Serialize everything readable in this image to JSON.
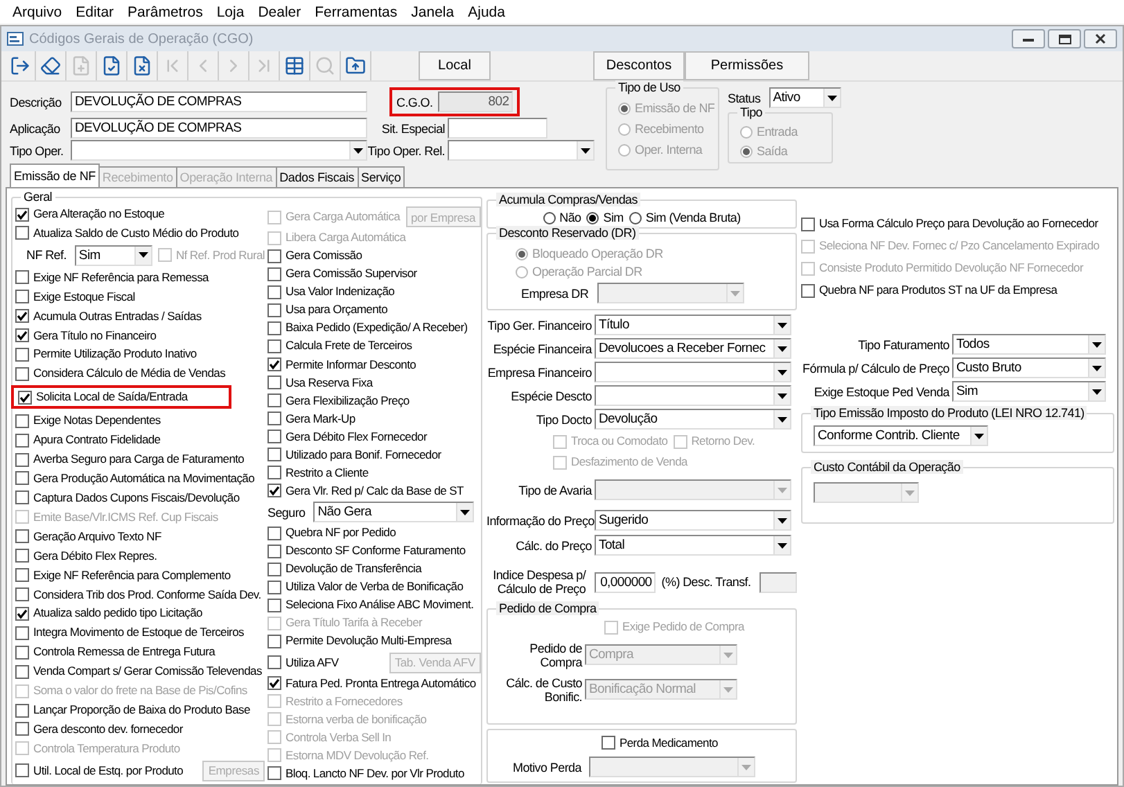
{
  "menu": [
    "Arquivo",
    "Editar",
    "Parâmetros",
    "Loja",
    "Dealer",
    "Ferramentas",
    "Janela",
    "Ajuda"
  ],
  "window": {
    "title": "Códigos Gerais de Operação (CGO)"
  },
  "toolbar": {
    "tools": [
      {
        "kind": "exit",
        "disabled": false
      },
      {
        "kind": "clear",
        "disabled": false
      },
      {
        "kind": "new",
        "disabled": true
      },
      {
        "kind": "save",
        "disabled": false
      },
      {
        "kind": "delete",
        "disabled": false
      },
      {
        "kind": "first",
        "disabled": true
      },
      {
        "kind": "previous",
        "disabled": true
      },
      {
        "kind": "next",
        "disabled": true
      },
      {
        "kind": "last",
        "disabled": true
      },
      {
        "kind": "grid",
        "disabled": false
      },
      {
        "kind": "search",
        "disabled": true
      },
      {
        "kind": "export",
        "disabled": false
      }
    ],
    "buttons": [
      {
        "label": "Local"
      },
      {
        "label": "Descontos"
      },
      {
        "label": "Permissões"
      }
    ]
  },
  "header": {
    "descricao": {
      "label": "Descrição",
      "value": "DEVOLUÇÃO DE COMPRAS"
    },
    "aplicacao": {
      "label": "Aplicação",
      "value": "DEVOLUÇÃO DE COMPRAS"
    },
    "tipo_oper": {
      "label": "Tipo Oper."
    },
    "cgo": {
      "label": "C.G.O.",
      "value": "802",
      "disabled": true,
      "highlighted": true
    },
    "sit_especial": {
      "label": "Sit. Especial"
    },
    "tipo_oper_rel": {
      "label": "Tipo Oper. Rel."
    },
    "tipo_de_uso": {
      "title": "Tipo de Uso",
      "disabled": true,
      "options": [
        {
          "label": "Emissão de NF",
          "selected": true
        },
        {
          "label": "Recebimento",
          "selected": false
        },
        {
          "label": "Oper. Interna",
          "selected": false
        }
      ]
    },
    "status": {
      "label": "Status",
      "value": "Ativo"
    },
    "tipo": {
      "title": "Tipo",
      "disabled": true,
      "options": [
        {
          "label": "Entrada",
          "selected": false
        },
        {
          "label": "Saída",
          "selected": true
        }
      ]
    }
  },
  "tabs": [
    {
      "label": "Emissão de NF",
      "selected": true,
      "disabled": false
    },
    {
      "label": "Recebimento",
      "selected": false,
      "disabled": true
    },
    {
      "label": "Operação Interna",
      "selected": false,
      "disabled": true
    },
    {
      "label": "Dados Fiscais",
      "selected": false,
      "disabled": false
    },
    {
      "label": "Serviço",
      "selected": false,
      "disabled": false
    }
  ],
  "geral": {
    "title": "Geral",
    "columns": [
      [
        {
          "kind": "checkbox",
          "label": "Gera Alteração no Estoque",
          "checked": true,
          "disabled": false
        },
        {
          "kind": "checkbox",
          "label": "Atualiza Saldo de Custo Médio do Produto",
          "checked": false,
          "disabled": false
        },
        {
          "kind": "select_check",
          "label": "NF Ref.",
          "value": "Sim",
          "check": {
            "label": "Nf Ref. Prod Rural",
            "checked": false,
            "disabled": true
          }
        },
        {
          "kind": "checkbox",
          "label": "Exige NF Referência para Remessa",
          "checked": false,
          "disabled": false
        },
        {
          "kind": "checkbox",
          "label": "Exige Estoque Fiscal",
          "checked": false,
          "disabled": false
        },
        {
          "kind": "checkbox",
          "label": "Acumula Outras Entradas / Saídas",
          "checked": true,
          "disabled": false
        },
        {
          "kind": "checkbox",
          "label": "Gera Título no Financeiro",
          "checked": true,
          "disabled": false
        },
        {
          "kind": "checkbox",
          "label": "Permite Utilização Produto Inativo",
          "checked": false,
          "disabled": false
        },
        {
          "kind": "checkbox",
          "label": "Considera Cálculo de Média de Vendas",
          "checked": false,
          "disabled": false
        },
        {
          "kind": "checkbox",
          "label": "Solicita Local de Saída/Entrada",
          "checked": true,
          "disabled": false,
          "highlighted": true
        },
        {
          "kind": "checkbox",
          "label": "Exige Notas Dependentes",
          "checked": false,
          "disabled": false
        },
        {
          "kind": "checkbox",
          "label": "Apura Contrato Fidelidade",
          "checked": false,
          "disabled": false
        },
        {
          "kind": "checkbox",
          "label": "Averba Seguro para Carga de Faturamento",
          "checked": false,
          "disabled": false
        },
        {
          "kind": "checkbox",
          "label": "Gera Produção Automática na Movimentação",
          "checked": false,
          "disabled": false
        },
        {
          "kind": "checkbox",
          "label": "Captura Dados Cupons Fiscais/Devolução",
          "checked": false,
          "disabled": false
        },
        {
          "kind": "checkbox",
          "label": "Emite Base/Vlr.ICMS Ref. Cup Fiscais",
          "checked": false,
          "disabled": true
        },
        {
          "kind": "checkbox",
          "label": "Geração Arquivo Texto NF",
          "checked": false,
          "disabled": false
        },
        {
          "kind": "checkbox",
          "label": "Gera Débito Flex Repres.",
          "checked": false,
          "disabled": false
        },
        {
          "kind": "checkbox",
          "label": "Exige NF Referência para Complemento",
          "checked": false,
          "disabled": false
        },
        {
          "kind": "checkbox",
          "label": "Considera Trib dos Prod. Conforme Saída Dev.",
          "checked": false,
          "disabled": false
        },
        {
          "kind": "checkbox",
          "label": "Atualiza saldo pedido tipo Licitação",
          "checked": true,
          "disabled": false
        },
        {
          "kind": "checkbox",
          "label": "Integra Movimento de Estoque de Terceiros",
          "checked": false,
          "disabled": false
        },
        {
          "kind": "checkbox",
          "label": "Controla Remessa de Entrega Futura",
          "checked": false,
          "disabled": false
        },
        {
          "kind": "checkbox",
          "label": "Venda Compart s/ Gerar Comissão Televendas",
          "checked": false,
          "disabled": false
        },
        {
          "kind": "checkbox",
          "label": "Soma o valor do frete na Base de Pis/Cofins",
          "checked": false,
          "disabled": true
        },
        {
          "kind": "checkbox",
          "label": "Lançar Proporção de Baixa do Produto Base",
          "checked": false,
          "disabled": false
        },
        {
          "kind": "checkbox",
          "label": "Gera desconto dev. fornecedor",
          "checked": false,
          "disabled": false
        },
        {
          "kind": "checkbox",
          "label": "Controla Temperatura Produto",
          "checked": false,
          "disabled": true
        },
        {
          "kind": "checkbox_button",
          "label": "Util. Local de Estq. por Produto",
          "checked": false,
          "disabled": false,
          "button": {
            "label": "Empresas",
            "disabled": true
          }
        }
      ],
      [
        {
          "kind": "checkbox_button",
          "label": "Gera Carga Automática",
          "checked": false,
          "disabled": true,
          "button": {
            "label": "por Empresa",
            "disabled": true
          }
        },
        {
          "kind": "checkbox",
          "label": "Libera Carga Automática",
          "checked": false,
          "disabled": true
        },
        {
          "kind": "checkbox",
          "label": "Gera Comissão",
          "checked": false,
          "disabled": false
        },
        {
          "kind": "checkbox",
          "label": "Gera Comissão Supervisor",
          "checked": false,
          "disabled": false
        },
        {
          "kind": "checkbox",
          "label": "Usa Valor Indenização",
          "checked": false,
          "disabled": false
        },
        {
          "kind": "checkbox",
          "label": "Usa para Orçamento",
          "checked": false,
          "disabled": false
        },
        {
          "kind": "checkbox",
          "label": "Baixa Pedido (Expedição/ A Receber)",
          "checked": false,
          "disabled": false
        },
        {
          "kind": "checkbox",
          "label": "Calcula Frete de Terceiros",
          "checked": false,
          "disabled": false
        },
        {
          "kind": "checkbox",
          "label": "Permite Informar Desconto",
          "checked": true,
          "disabled": false
        },
        {
          "kind": "checkbox",
          "label": "Usa Reserva Fixa",
          "checked": false,
          "disabled": false
        },
        {
          "kind": "checkbox",
          "label": "Gera Flexibilização Preço",
          "checked": false,
          "disabled": false
        },
        {
          "kind": "checkbox",
          "label": "Gera Mark-Up",
          "checked": false,
          "disabled": false
        },
        {
          "kind": "checkbox",
          "label": "Gera Débito Flex Fornecedor",
          "checked": false,
          "disabled": false
        },
        {
          "kind": "checkbox",
          "label": "Utilizado para Bonif. Fornecedor",
          "checked": false,
          "disabled": false
        },
        {
          "kind": "checkbox",
          "label": "Restrito a Cliente",
          "checked": false,
          "disabled": false
        },
        {
          "kind": "checkbox",
          "label": "Gera Vlr. Red p/ Calc da Base de ST",
          "checked": true,
          "disabled": false
        },
        {
          "kind": "select",
          "label": "Seguro",
          "value": "Não Gera"
        },
        {
          "kind": "checkbox",
          "label": "Quebra NF por Pedido",
          "checked": false,
          "disabled": false
        },
        {
          "kind": "checkbox",
          "label": "Desconto SF Conforme Faturamento",
          "checked": false,
          "disabled": false
        },
        {
          "kind": "checkbox",
          "label": "Devolução de Transferência",
          "checked": false,
          "disabled": false
        },
        {
          "kind": "checkbox",
          "label": "Utiliza Valor de Verba de Bonificação",
          "checked": false,
          "disabled": false
        },
        {
          "kind": "checkbox",
          "label": "Seleciona Fixo Análise ABC Moviment.",
          "checked": false,
          "disabled": false
        },
        {
          "kind": "checkbox",
          "label": "Gera Título Tarifa à Receber",
          "checked": false,
          "disabled": true
        },
        {
          "kind": "checkbox",
          "label": "Permite Devolução Multi-Empresa",
          "checked": false,
          "disabled": false
        },
        {
          "kind": "checkbox_button",
          "label": "Utiliza AFV",
          "checked": false,
          "disabled": false,
          "button": {
            "label": "Tab. Venda AFV",
            "disabled": true
          }
        },
        {
          "kind": "checkbox",
          "label": "Fatura Ped. Pronta Entrega Automático",
          "checked": true,
          "disabled": false
        },
        {
          "kind": "checkbox",
          "label": "Restrito a Fornecedores",
          "checked": false,
          "disabled": true
        },
        {
          "kind": "checkbox",
          "label": "Estorna verba de bonificação",
          "checked": false,
          "disabled": true
        },
        {
          "kind": "checkbox",
          "label": "Controla Verba Sell In",
          "checked": false,
          "disabled": true
        },
        {
          "kind": "checkbox",
          "label": "Estorna MDV Devolução Ref.",
          "checked": false,
          "disabled": true
        },
        {
          "kind": "checkbox",
          "label": "Bloq. Lancto NF Dev. por Vlr Produto",
          "checked": false,
          "disabled": false
        }
      ]
    ]
  },
  "compras": {
    "acumula": {
      "title": "Acumula Compras/Vendas",
      "options": [
        {
          "label": "Não",
          "selected": false
        },
        {
          "label": "Sim",
          "selected": true
        },
        {
          "label": "Sim (Venda Bruta)",
          "selected": false
        }
      ]
    },
    "desconto_reservado": {
      "title": "Desconto Reservado (DR)",
      "disabled": true,
      "options": [
        {
          "label": "Bloqueado Operação DR",
          "selected": true
        },
        {
          "label": "Operação Parcial DR",
          "selected": false
        }
      ],
      "empresa": {
        "label": "Empresa DR",
        "disabled": true
      }
    },
    "financeiro": [
      {
        "label": "Tipo Ger. Financeiro",
        "value": "Título",
        "disabled": false
      },
      {
        "label": "Espécie Financeira",
        "value": "Devolucoes a Receber Fornec",
        "disabled": false
      },
      {
        "label": "Empresa Financeiro",
        "disabled": false
      },
      {
        "label": "Espécie Descto",
        "disabled": false
      },
      {
        "label": "Tipo Docto",
        "value": "Devolução",
        "disabled": false
      }
    ],
    "docto_checks": [
      {
        "label": "Troca ou Comodato",
        "checked": false,
        "disabled": true
      },
      {
        "label": "Retorno Dev.",
        "checked": false,
        "disabled": true
      },
      {
        "label": "Desfazimento de Venda",
        "checked": false,
        "disabled": true
      }
    ],
    "avaria": {
      "label": "Tipo de Avaria",
      "disabled": true
    },
    "preco": [
      {
        "label": "Informação do Preço",
        "value": "Sugerido",
        "disabled": false
      },
      {
        "label": "Cálc. do Preço",
        "value": "Total",
        "disabled": false
      }
    ],
    "indice": {
      "label": "Indice Despesa p/ Cálculo de Preço",
      "value": "0,000000",
      "desc_label": "(%) Desc. Transf."
    },
    "pedido_compra": {
      "title": "Pedido de Compra",
      "exige": {
        "label": "Exige Pedido de Compra",
        "checked": false,
        "disabled": true
      },
      "fields": [
        {
          "label": "Pedido de Compra",
          "value": "Compra",
          "disabled": true
        },
        {
          "label": "Cálc. de Custo Bonific.",
          "value": "Bonificação Normal",
          "disabled": true
        }
      ]
    },
    "perda": {
      "check": {
        "label": "Perda Medicamento",
        "checked": false,
        "disabled": false
      },
      "motivo": {
        "label": "Motivo Perda",
        "disabled": true
      }
    }
  },
  "devolucao": {
    "checks": [
      {
        "label": "Usa Forma Cálculo Preço para Devolução ao Fornecedor",
        "checked": false,
        "disabled": false
      },
      {
        "label": "Seleciona NF Dev. Fornec c/ Pzo Cancelamento Expirado",
        "checked": false,
        "disabled": true
      },
      {
        "label": "Consiste Produto Permitido Devolução NF Fornecedor",
        "checked": false,
        "disabled": true
      },
      {
        "label": "Quebra NF para Produtos ST na UF da Empresa",
        "checked": false,
        "disabled": false
      }
    ],
    "fields": [
      {
        "label": "Tipo Faturamento",
        "value": "Todos",
        "disabled": false
      },
      {
        "label": "Fórmula p/ Cálculo de Preço",
        "value": "Custo Bruto",
        "disabled": false
      },
      {
        "label": "Exige Estoque Ped Venda",
        "value": "Sim",
        "disabled": false
      }
    ],
    "imposto": {
      "title": "Tipo Emissão Imposto do Produto (LEI NRO 12.741)",
      "value": "Conforme Contrib. Cliente"
    },
    "custo": {
      "title": "Custo Contábil da Operação",
      "disabled": true
    }
  }
}
